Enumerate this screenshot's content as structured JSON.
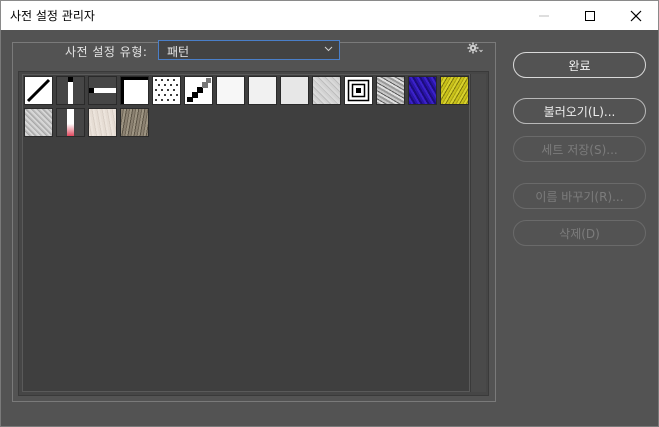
{
  "window": {
    "title": "사전 설정 관리자",
    "minimize_icon": "minimize-icon",
    "maximize_icon": "maximize-icon",
    "close_icon": "close-icon"
  },
  "preset_type": {
    "label": "사전 설정 유형:",
    "selected": "패턴",
    "options_icon": "gear-icon"
  },
  "patterns": [
    {
      "name": "diagonal-line"
    },
    {
      "name": "vertical-bar"
    },
    {
      "name": "horizontal-bar"
    },
    {
      "name": "white-square"
    },
    {
      "name": "dots"
    },
    {
      "name": "diagonal-stair"
    },
    {
      "name": "white-1"
    },
    {
      "name": "white-2"
    },
    {
      "name": "light-gray"
    },
    {
      "name": "gray-noise"
    },
    {
      "name": "concentric-squares"
    },
    {
      "name": "gray-marble"
    },
    {
      "name": "purple-texture"
    },
    {
      "name": "yellow-texture"
    },
    {
      "name": "gray-granite"
    },
    {
      "name": "red-gradient"
    },
    {
      "name": "beige-paper"
    },
    {
      "name": "brown-stone"
    }
  ],
  "buttons": {
    "done": "완료",
    "load": "불러오기(L)...",
    "save_set": "세트 저장(S)...",
    "rename": "이름 바꾸기(R)...",
    "delete": "삭제(D)"
  },
  "colors": {
    "background": "#535353",
    "accent": "#4a7fc9"
  }
}
